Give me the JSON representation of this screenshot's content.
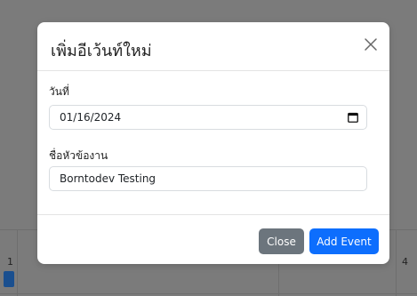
{
  "modal": {
    "title": "เพิ่มอีเว้นท์ใหม่",
    "close_icon": "close-icon",
    "date_label": "วันที่",
    "date_value": "01/16/2024",
    "date_icon": "calendar-icon",
    "name_label": "ชื่อหัวข้องาน",
    "name_value": "Borntodev Testing",
    "close_button_label": "Close",
    "add_button_label": "Add Event"
  },
  "calendar_bg": {
    "day_left": "1",
    "day_right": "4"
  },
  "colors": {
    "primary": "#0d6efd",
    "secondary": "#6c757d",
    "backdrop": "#7b7b7b"
  }
}
